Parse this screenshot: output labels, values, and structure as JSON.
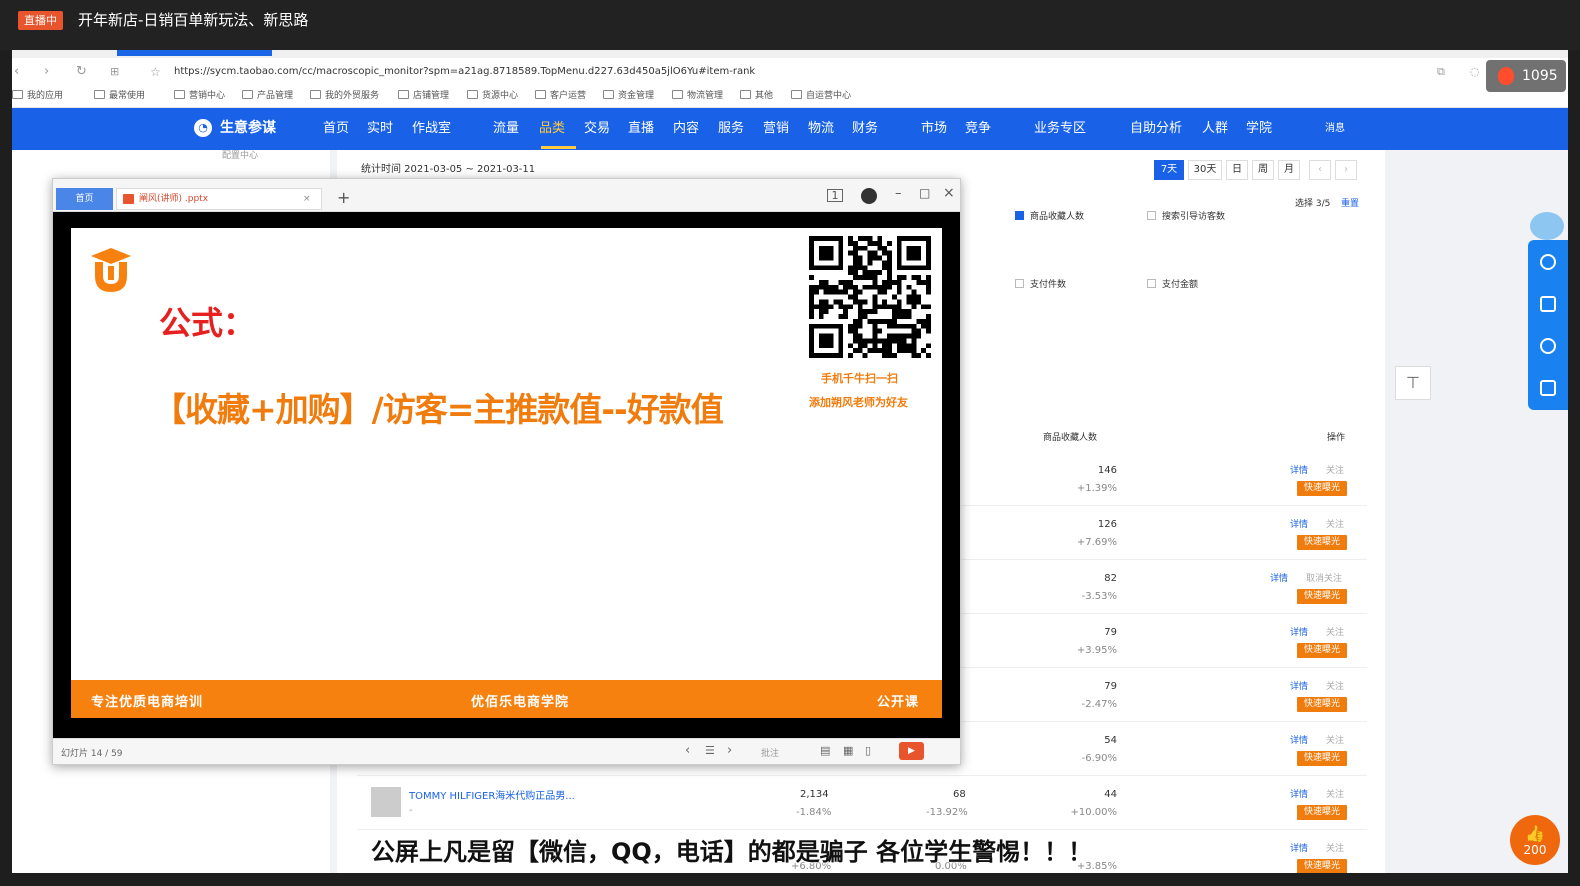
{
  "stream": {
    "live_badge": "直播中",
    "title": "开年新店-日销百单新玩法、新思路",
    "viewers": "1095",
    "likes": "200",
    "warning": "公屏上凡是留【微信，QQ，电话】的都是骗子 各位学生警惕！！！"
  },
  "browser": {
    "url": "https://sycm.taobao.com/cc/macroscopic_monitor?spm=a21ag.8718589.TopMenu.d227.63d450a5jlO6Yu#item-rank",
    "bookmarks": [
      "我的应用",
      "最常使用",
      "营销中心",
      "产品管理",
      "我的外贸服务",
      "店铺管理",
      "货源中心",
      "客户运营",
      "资金管理",
      "物流管理",
      "其他",
      "自运营中心"
    ]
  },
  "app": {
    "brand": "生意参谋",
    "menu": [
      "首页",
      "实时",
      "作战室",
      "流量",
      "品类",
      "交易",
      "直播",
      "内容",
      "服务",
      "营销",
      "物流",
      "财务",
      "市场",
      "竞争",
      "业务专区",
      "自助分析",
      "人群",
      "学院"
    ],
    "active_menu": "品类",
    "messages": "消息",
    "left_nav_item": "配置中心"
  },
  "filters": {
    "date_range": "统计时间 2021-03-05 ~ 2021-03-11",
    "periods": [
      "7天",
      "30天",
      "日",
      "周",
      "月"
    ],
    "active_period": "7天",
    "select_count": "选择 3/5",
    "reset": "重置",
    "metrics": [
      {
        "label": "商品收藏人数",
        "checked": true
      },
      {
        "label": "搜索引导访客数",
        "checked": false
      },
      {
        "label": "支付件数",
        "checked": false
      },
      {
        "label": "支付金额",
        "checked": false
      }
    ]
  },
  "table": {
    "col_fav": "商品收藏人数",
    "col_ops": "操作",
    "rows": [
      {
        "fav": "146",
        "fav_pct": "+1.39%",
        "detail": "详情",
        "follow": "关注",
        "btn": "快速曝光"
      },
      {
        "fav": "126",
        "fav_pct": "+7.69%",
        "detail": "详情",
        "follow": "关注",
        "btn": "快速曝光"
      },
      {
        "fav": "82",
        "fav_pct": "-3.53%",
        "detail": "详情",
        "follow": "取消关注",
        "btn": "快速曝光"
      },
      {
        "fav": "79",
        "fav_pct": "+3.95%",
        "detail": "详情",
        "follow": "关注",
        "btn": "快速曝光"
      },
      {
        "fav": "79",
        "fav_pct": "-2.47%",
        "detail": "详情",
        "follow": "关注",
        "btn": "快速曝光"
      },
      {
        "fav": "54",
        "fav_pct": "-6.90%",
        "detail": "详情",
        "follow": "关注",
        "btn": "快速曝光"
      },
      {
        "fav": "44",
        "fav_pct": "+10.00%",
        "detail": "详情",
        "follow": "关注",
        "btn": "快速曝光"
      },
      {
        "fav": "",
        "fav_pct": "+3.85%",
        "detail": "详情",
        "follow": "关注",
        "btn": "快速曝光"
      }
    ],
    "product_row": {
      "name": "TOMMY HILFIGER海米代购正品男...",
      "dash": "-",
      "visitors": "2,134",
      "visitors_pct": "-1.84%",
      "col3": "68",
      "col3_pct": "-13.92%"
    },
    "last_row": {
      "col2_pct": "+6.80%",
      "col3_pct": "0.00%"
    }
  },
  "ppt": {
    "home_tab": "首页",
    "file_tab": "阐风(讲师) .pptx",
    "slide_counter": "幻灯片 14 / 59",
    "notes": "批注",
    "slide": {
      "title": "公式：",
      "formula": "【收藏+加购】/访客=主推款值--好款值",
      "qr_line1": "手机千牛扫一扫",
      "qr_line2": "添加朔风老师为好友",
      "footer_left": "专注优质电商培训",
      "footer_center": "优佰乐电商学院",
      "footer_right": "公开课"
    }
  }
}
